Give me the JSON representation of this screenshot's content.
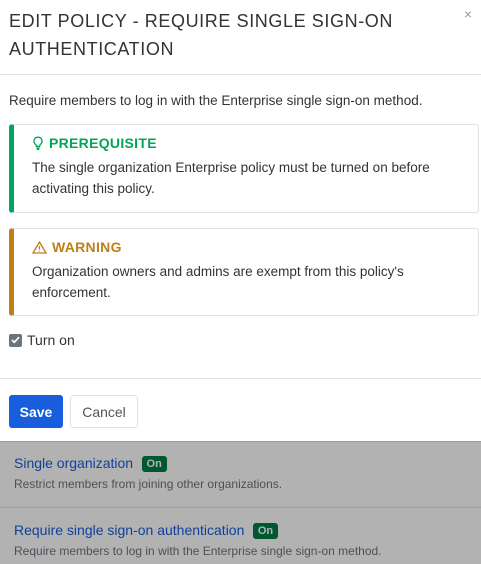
{
  "modal": {
    "title": "EDIT POLICY - REQUIRE SINGLE SIGN-ON AUTHENTICATION",
    "close_icon": "close-icon",
    "intro": "Require members to log in with the Enterprise single sign-on method.",
    "prerequisite": {
      "icon": "lightbulb-icon",
      "title": "PREREQUISITE",
      "text": "The single organization Enterprise policy must be turned on before activating this policy.",
      "accent": "#00a65a"
    },
    "warning": {
      "icon": "warning-triangle-icon",
      "title": "WARNING",
      "text": "Organization owners and admins are exempt from this policy's enforcement.",
      "accent": "#bf7e16"
    },
    "turn_on_label": "Turn on",
    "turn_on_checked": true,
    "save_label": "Save",
    "cancel_label": "Cancel",
    "save_color": "#175ddc"
  },
  "policies": [
    {
      "name": "Single organization",
      "badge": "On",
      "description": "Restrict members from joining other organizations."
    },
    {
      "name": "Require single sign-on authentication",
      "badge": "On",
      "description": "Require members to log in with the Enterprise single sign-on method."
    }
  ]
}
